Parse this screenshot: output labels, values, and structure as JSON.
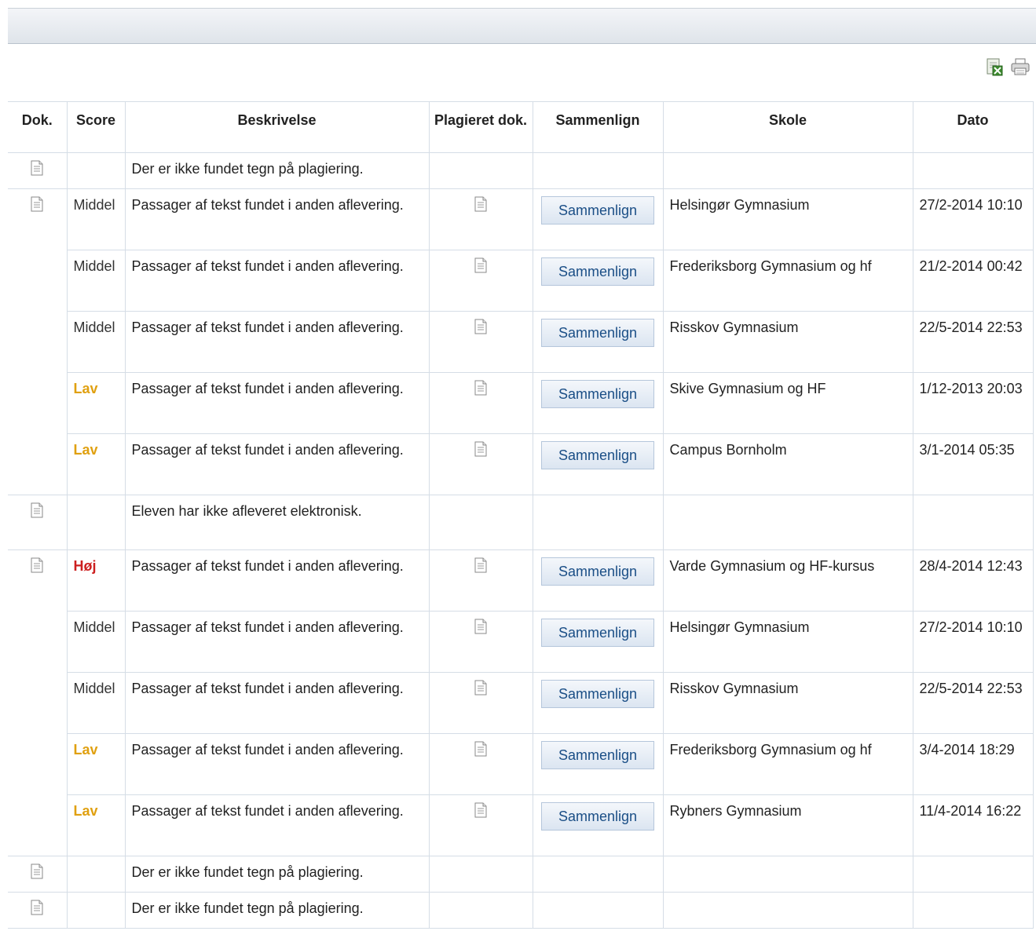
{
  "toolbar": {
    "export_icon": "excel-export-icon",
    "print_icon": "printer-icon"
  },
  "table": {
    "headers": {
      "dok": "Dok.",
      "score": "Score",
      "beskrivelse": "Beskrivelse",
      "plagieret": "Plagieret dok.",
      "sammenlign": "Sammenlign",
      "skole": "Skole",
      "dato": "Dato"
    },
    "rows": [
      {
        "dok": true,
        "score": "",
        "beskrivelse": "Der er ikke fundet tegn på plagiering.",
        "plag": false,
        "compare": "",
        "skole": "",
        "dato": ""
      },
      {
        "dok": true,
        "score": "Middel",
        "beskrivelse": "Passager af tekst fundet i anden aflevering.",
        "plag": true,
        "compare": "Sammenlign",
        "skole": "Helsingør Gymnasium",
        "dato": "27/2-2014 10:10"
      },
      {
        "dok": false,
        "score": "Middel",
        "beskrivelse": "Passager af tekst fundet i anden aflevering.",
        "plag": true,
        "compare": "Sammenlign",
        "skole": "Frederiksborg Gymnasium og hf",
        "dato": "21/2-2014 00:42"
      },
      {
        "dok": false,
        "score": "Middel",
        "beskrivelse": "Passager af tekst fundet i anden aflevering.",
        "plag": true,
        "compare": "Sammenlign",
        "skole": "Risskov Gymnasium",
        "dato": "22/5-2014 22:53"
      },
      {
        "dok": false,
        "score": "Lav",
        "beskrivelse": "Passager af tekst fundet i anden aflevering.",
        "plag": true,
        "compare": "Sammenlign",
        "skole": "Skive Gymnasium og HF",
        "dato": "1/12-2013 20:03"
      },
      {
        "dok": false,
        "score": "Lav",
        "beskrivelse": "Passager af tekst fundet i anden aflevering.",
        "plag": true,
        "compare": "Sammenlign",
        "skole": "Campus Bornholm",
        "dato": "3/1-2014 05:35"
      },
      {
        "dok": true,
        "score": "",
        "beskrivelse": "Eleven har ikke afleveret elektronisk.",
        "plag": false,
        "compare": "",
        "skole": "",
        "dato": ""
      },
      {
        "dok": true,
        "score": "Høj",
        "beskrivelse": "Passager af tekst fundet i anden aflevering.",
        "plag": true,
        "compare": "Sammenlign",
        "skole": "Varde Gymnasium og HF-kursus",
        "dato": "28/4-2014 12:43"
      },
      {
        "dok": false,
        "score": "Middel",
        "beskrivelse": "Passager af tekst fundet i anden aflevering.",
        "plag": true,
        "compare": "Sammenlign",
        "skole": "Helsingør Gymnasium",
        "dato": "27/2-2014 10:10"
      },
      {
        "dok": false,
        "score": "Middel",
        "beskrivelse": "Passager af tekst fundet i anden aflevering.",
        "plag": true,
        "compare": "Sammenlign",
        "skole": "Risskov Gymnasium",
        "dato": "22/5-2014 22:53"
      },
      {
        "dok": false,
        "score": "Lav",
        "beskrivelse": "Passager af tekst fundet i anden aflevering.",
        "plag": true,
        "compare": "Sammenlign",
        "skole": "Frederiksborg Gymnasium og hf",
        "dato": "3/4-2014 18:29"
      },
      {
        "dok": false,
        "score": "Lav",
        "beskrivelse": "Passager af tekst fundet i anden aflevering.",
        "plag": true,
        "compare": "Sammenlign",
        "skole": "Rybners Gymnasium",
        "dato": "11/4-2014 16:22"
      },
      {
        "dok": true,
        "score": "",
        "beskrivelse": "Der er ikke fundet tegn på plagiering.",
        "plag": false,
        "compare": "",
        "skole": "",
        "dato": ""
      },
      {
        "dok": true,
        "score": "",
        "beskrivelse": "Der er ikke fundet tegn på plagiering.",
        "plag": false,
        "compare": "",
        "skole": "",
        "dato": ""
      }
    ]
  },
  "colors": {
    "score_hoj": "#cc1f1f",
    "score_lav": "#e0a010",
    "button_text": "#1a4e86",
    "grid": "#d5dde6"
  }
}
